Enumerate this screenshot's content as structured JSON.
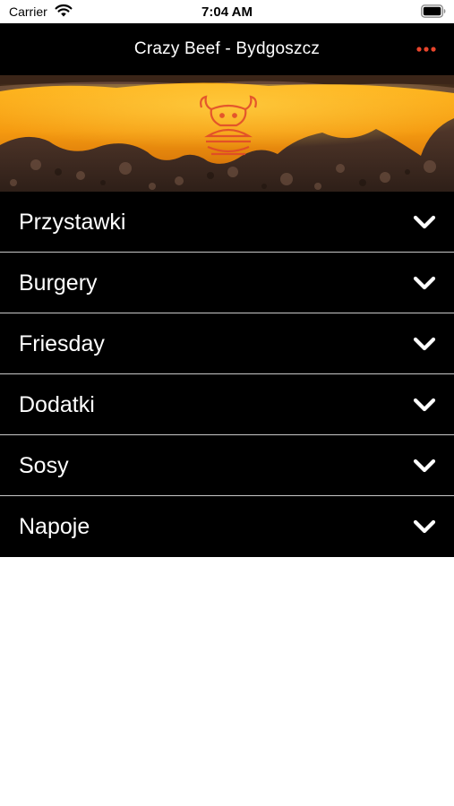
{
  "status_bar": {
    "carrier": "Carrier",
    "time": "7:04 AM"
  },
  "nav": {
    "title": "Crazy Beef - Bydgoszcz",
    "more_icon": "ellipsis-icon",
    "accent_color": "#e8452c"
  },
  "banner": {
    "image": "cheeseburger-banner",
    "logo_icon": "bull-logo"
  },
  "menu": {
    "items": [
      {
        "label": "Przystawki"
      },
      {
        "label": "Burgery"
      },
      {
        "label": "Friesday"
      },
      {
        "label": "Dodatki"
      },
      {
        "label": "Sosy"
      },
      {
        "label": "Napoje"
      }
    ],
    "chevron_icon": "chevron-down-icon"
  }
}
